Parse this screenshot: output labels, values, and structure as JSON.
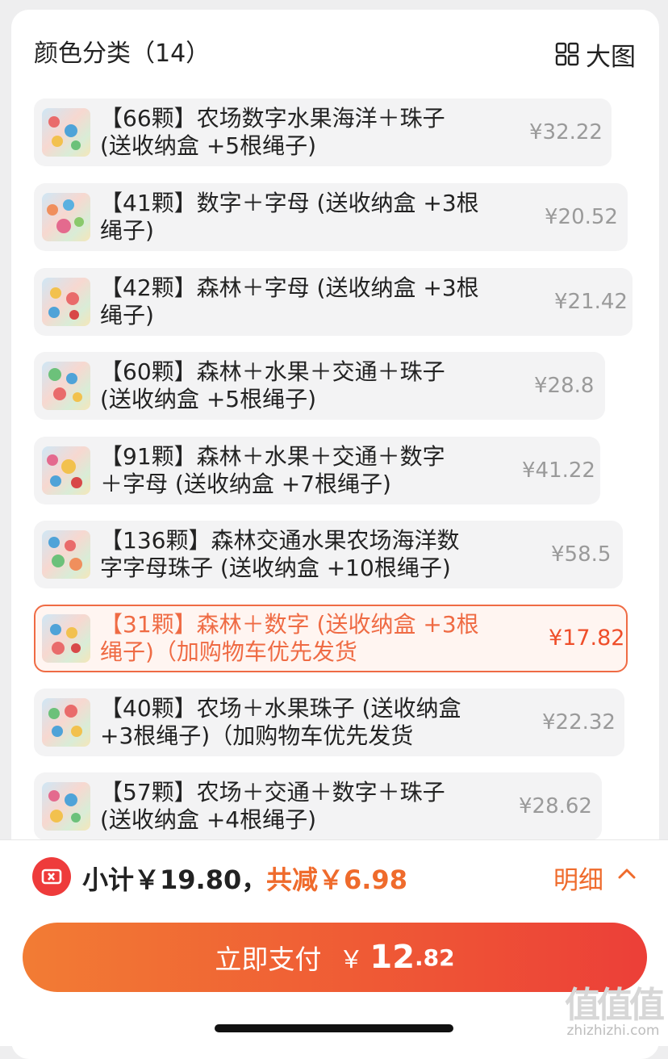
{
  "header": {
    "title": "颜色分类（14）",
    "big_view_label": "大图",
    "big_view_icon": "grid-icon"
  },
  "items": [
    {
      "line1": "【66颗】农场数字水果海洋＋珠子",
      "line2": "(送收纳盒 +5根绳子)",
      "price": "¥32.22",
      "selected": false
    },
    {
      "line1": "【41颗】数字＋字母 (送收纳盒 +3根",
      "line2": "绳子)",
      "price": "¥20.52",
      "selected": false
    },
    {
      "line1": "【42颗】森林＋字母 (送收纳盒 +3根",
      "line2": "绳子)",
      "price": "¥21.42",
      "selected": false
    },
    {
      "line1": "【60颗】森林＋水果＋交通＋珠子",
      "line2": "(送收纳盒 +5根绳子)",
      "price": "¥28.8",
      "selected": false
    },
    {
      "line1": "【91颗】森林＋水果＋交通＋数字",
      "line2": "＋字母 (送收纳盒 +7根绳子)",
      "price": "¥41.22",
      "selected": false
    },
    {
      "line1": "【136颗】森林交通水果农场海洋数",
      "line2": "字字母珠子 (送收纳盒 +10根绳子)",
      "price": "¥58.5",
      "selected": false
    },
    {
      "line1": "【31颗】森林＋数字 (送收纳盒 +3根",
      "line2": "绳子)（加购物车优先发货",
      "price": "¥17.82",
      "selected": true
    },
    {
      "line1": "【40颗】农场＋水果珠子 (送收纳盒",
      "line2": "+3根绳子)（加购物车优先发货",
      "price": "¥22.32",
      "selected": false
    },
    {
      "line1": "【57颗】农场＋交通＋数字＋珠子",
      "line2": "(送收纳盒 +4根绳子)",
      "price": "¥28.62",
      "selected": false
    }
  ],
  "summary": {
    "subtotal": "小计￥19.80，",
    "discount": "共减￥6.98",
    "detail_label": "明细",
    "coupon_icon": "coupon-icon",
    "chevron_icon": "chevron-up-icon"
  },
  "pay": {
    "label": "立即支付",
    "currency": "￥",
    "amount_int": "12",
    "amount_dec": ".82"
  },
  "watermark": {
    "logo": "值值值",
    "site": "zhizhizhi.com"
  },
  "colors": {
    "accent": "#ef6b2c",
    "selected_border": "#ef6b44",
    "pay_gradient_start": "#f27c34",
    "pay_gradient_end": "#ec3f38"
  }
}
